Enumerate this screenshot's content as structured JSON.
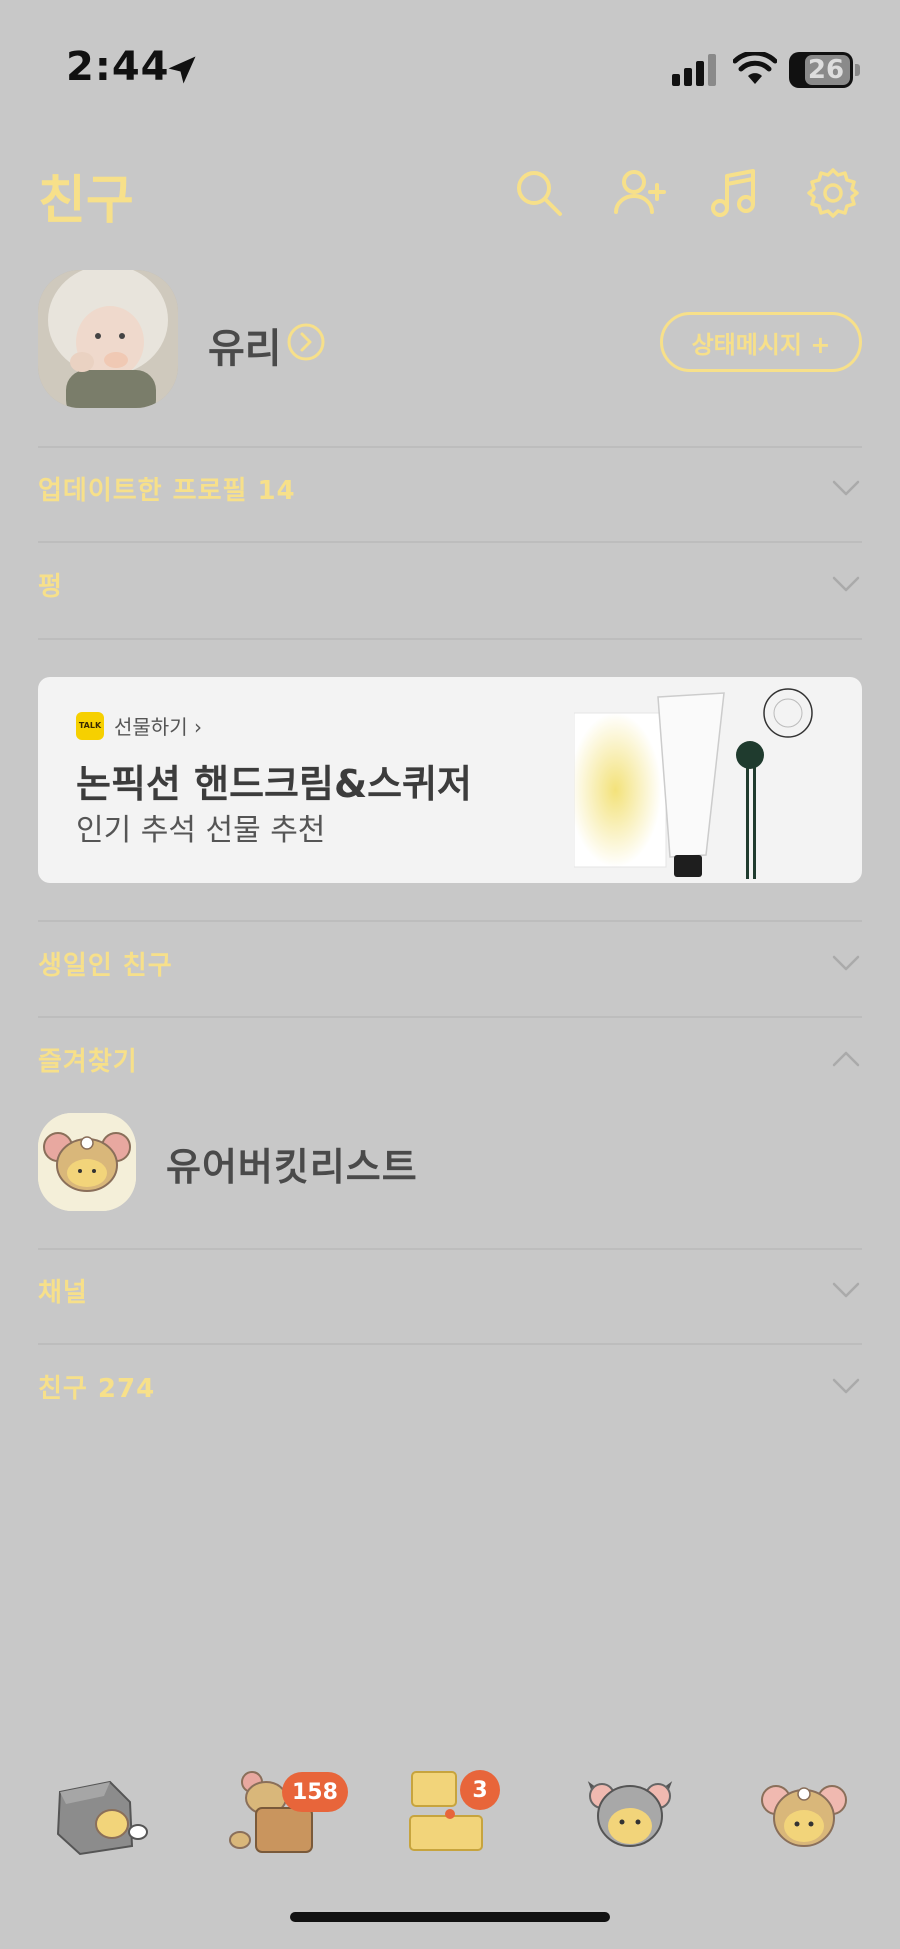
{
  "status_bar": {
    "time": "2:44",
    "battery": "26"
  },
  "header": {
    "title": "친구",
    "icons": [
      "search-icon",
      "add-friend-icon",
      "music-icon",
      "settings-icon"
    ]
  },
  "profile": {
    "name": "유리",
    "status_button": "상태메시지 +"
  },
  "sections": {
    "updated_profiles": "업데이트한 프로필 14",
    "pung": "펑",
    "birthday_friends": "생일인 친구",
    "favorites": "즐겨찾기",
    "channel": "채널",
    "friends": "친구 274"
  },
  "banner": {
    "badge": "TALK",
    "gift_label": "선물하기 ›",
    "title": "논픽션 핸드크림&스퀴저",
    "subtitle": "인기 추석 선물 추천"
  },
  "favorites": [
    {
      "name": "유어버킷리스트"
    }
  ],
  "tab_bar": {
    "tabs": [
      {
        "name": "friends-tab",
        "badge": ""
      },
      {
        "name": "chats-tab",
        "badge": "158"
      },
      {
        "name": "openchat-tab",
        "badge": "3"
      },
      {
        "name": "shopping-tab",
        "badge": ""
      },
      {
        "name": "more-tab",
        "badge": ""
      }
    ]
  },
  "colors": {
    "background": "#c8c8c8",
    "accent": "#f7e08a",
    "badge": "#e8653a"
  }
}
